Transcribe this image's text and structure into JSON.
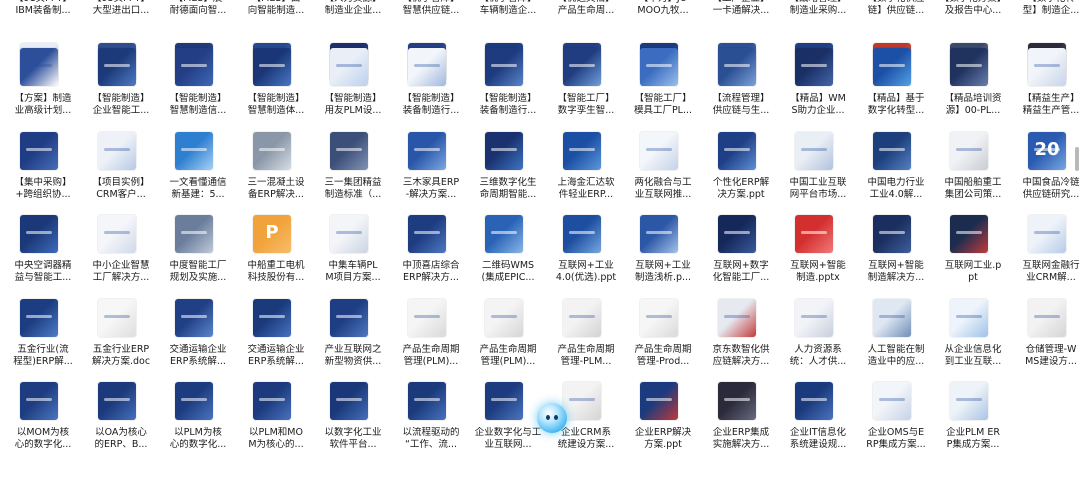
{
  "files": [
    {
      "line1": "【91页PPT】",
      "line2": "IBM装备制...",
      "thumb": "#e8eef8",
      "thumb_b": "#c9d7ef",
      "thumb_text": "",
      "light": true
    },
    {
      "line1": "【93页PPT】",
      "line2": "大型进出口...",
      "thumb": "#2f4d8e",
      "thumb_b": "#5b86c9",
      "thumb_text": ""
    },
    {
      "line1": "【MES】展",
      "line2": "耐德面向智...",
      "thumb": "#1f3a78",
      "thumb_b": "#4a6fb5",
      "thumb_text": ""
    },
    {
      "line1": "【MES】面",
      "line2": "向智能制造...",
      "thumb": "#274a8f",
      "thumb_b": "#6f93d1",
      "thumb_text": ""
    },
    {
      "line1": "【人力资源】",
      "line2": "制造业企业...",
      "thumb": "#1d2f6b",
      "thumb_b": "#3b5aa8",
      "thumb_text": ""
    },
    {
      "line1": "【优学智库】",
      "line2": "智慧供应链...",
      "thumb": "#243f86",
      "thumb_b": "#5c7fc6",
      "thumb_text": ""
    },
    {
      "line1": "【优学智库】",
      "line2": "车辆制造企...",
      "thumb": "#1b3c7c",
      "thumb_b": "#2f6bc0",
      "thumb_text": ""
    },
    {
      "line1": "【优选文档】",
      "line2": "产品生命周...",
      "thumb": "#233d83",
      "thumb_b": "#4e76c2",
      "thumb_text": ""
    },
    {
      "line1": "【华为】JO",
      "line2": "MOO九牧...",
      "thumb": "#1a3b7d",
      "thumb_b": "#3f6cc0",
      "thumb_text": ""
    },
    {
      "line1": "【工厂企业】",
      "line2": "一卡通解决...",
      "thumb": "#2c4f95",
      "thumb_b": "#8aa8dc",
      "thumb_text": ""
    },
    {
      "line1": "【战略管理】",
      "line2": "制造业采购...",
      "thumb": "#1f3f83",
      "thumb_b": "#5e84c8",
      "thumb_text": ""
    },
    {
      "line1": "【数字化供应",
      "line2": "链】供应链...",
      "thumb": "#c0392b",
      "thumb_b": "#e07a5f",
      "thumb_text": ""
    },
    {
      "line1": "【数字化方案】",
      "line2": "及报告中心...",
      "thumb": "#3a4a6b",
      "thumb_b": "#c9b18a",
      "thumb_text": ""
    },
    {
      "line1": "【数字化转",
      "line2": "型】制造企...",
      "thumb": "#2b2b3a",
      "thumb_b": "#7a7fa0",
      "thumb_text": ""
    },
    {
      "line1": "【方案】制造",
      "line2": "业高级计划...",
      "thumb": "#2d4f9a",
      "thumb_b": "#ffffff",
      "thumb_text": "",
      "light": true
    },
    {
      "line1": "【智能制造】",
      "line2": "企业智能工...",
      "thumb": "#1c3a7a",
      "thumb_b": "#4f7bc4",
      "thumb_text": ""
    },
    {
      "line1": "【智能制造】",
      "line2": "智慧制造信...",
      "thumb": "#233e85",
      "thumb_b": "#3d69b8",
      "thumb_text": ""
    },
    {
      "line1": "【智能制造】",
      "line2": "智慧制造体...",
      "thumb": "#1a3676",
      "thumb_b": "#4a78c4",
      "thumb_text": ""
    },
    {
      "line1": "【智能制造】",
      "line2": "用友PLM设...",
      "thumb": "#e9eef7",
      "thumb_b": "#bcd0ec",
      "thumb_text": "",
      "light": true
    },
    {
      "line1": "【智能制造】",
      "line2": "装备制造行...",
      "thumb": "#f2f5fa",
      "thumb_b": "#9fb8de",
      "thumb_text": "",
      "light": true
    },
    {
      "line1": "【智能制造】",
      "line2": "装备制造行...",
      "thumb": "#1d3b7e",
      "thumb_b": "#5a85c9",
      "thumb_text": ""
    },
    {
      "line1": "【智能工厂】",
      "line2": "数字孪生智...",
      "thumb": "#203d80",
      "thumb_b": "#6fa0dc",
      "thumb_text": ""
    },
    {
      "line1": "【智能工厂】",
      "line2": "模具工厂PL...",
      "thumb": "#3a6cc0",
      "thumb_b": "#9cc0ec",
      "thumb_text": ""
    },
    {
      "line1": "【流程管理】",
      "line2": "供应链与生...",
      "thumb": "#2a4f93",
      "thumb_b": "#7da2da",
      "thumb_text": ""
    },
    {
      "line1": "【精品】WM",
      "line2": "S助力企业...",
      "thumb": "#192f66",
      "thumb_b": "#4466aa",
      "thumb_text": ""
    },
    {
      "line1": "【精品】基于",
      "line2": "数字化转型...",
      "thumb": "#1c4fa6",
      "thumb_b": "#53a1e6",
      "thumb_text": ""
    },
    {
      "line1": "【精品培训资",
      "line2": "源】00-PL...",
      "thumb": "#20325e",
      "thumb_b": "#6a7fae",
      "thumb_text": ""
    },
    {
      "line1": "【精益生产】",
      "line2": "精益生产管...",
      "thumb": "#f1f4f9",
      "thumb_b": "#c7d4ea",
      "thumb_text": "",
      "light": true
    },
    {
      "line1": "【集中采购】",
      "line2": "+跨组织协...",
      "thumb": "#1f3d84",
      "thumb_b": "#486fba",
      "thumb_text": ""
    },
    {
      "line1": "【项目实例】",
      "line2": "CRM客户...",
      "thumb": "#eef2f8",
      "thumb_b": "#b8c9e4",
      "thumb_text": "",
      "light": true
    },
    {
      "line1": "一文看懂通信",
      "line2": "新基建：5...",
      "thumb": "#2f7fd0",
      "thumb_b": "#a5d2f5",
      "thumb_text": ""
    },
    {
      "line1": "三一混凝土设",
      "line2": "备ERP解决...",
      "thumb": "#8a97a8",
      "thumb_b": "#d7dde6",
      "thumb_text": ""
    },
    {
      "line1": "三一集团精益",
      "line2": "制造标准（...",
      "thumb": "#3b4f78",
      "thumb_b": "#8293b5",
      "thumb_text": ""
    },
    {
      "line1": "三木家具ERP",
      "line2": "-解决方案...",
      "thumb": "#2956a8",
      "thumb_b": "#7ca8e3",
      "thumb_text": ""
    },
    {
      "line1": "三维数字化生",
      "line2": "命周期智能...",
      "thumb": "#1a3370",
      "thumb_b": "#3f74c5",
      "thumb_text": ""
    },
    {
      "line1": "上海金汇达软",
      "line2": "件轻业ERP...",
      "thumb": "#1a4fa3",
      "thumb_b": "#5e97dc",
      "thumb_text": ""
    },
    {
      "line1": "两化融合与工",
      "line2": "业互联网推...",
      "thumb": "#f3f6fa",
      "thumb_b": "#c3d2ea",
      "thumb_text": "",
      "light": true
    },
    {
      "line1": "个性化ERP解",
      "line2": "决方案.ppt",
      "thumb": "#1e3f86",
      "thumb_b": "#5f8fd5",
      "thumb_text": ""
    },
    {
      "line1": "中国工业互联",
      "line2": "网平台市场...",
      "thumb": "#eaeef5",
      "thumb_b": "#b1c2de",
      "thumb_text": "",
      "light": true
    },
    {
      "line1": "中国电力行业",
      "line2": "工业4.0解...",
      "thumb": "#1d3f7c",
      "thumb_b": "#5680c2",
      "thumb_text": ""
    },
    {
      "line1": "中国船舶重工",
      "line2": "集团公司策...",
      "thumb": "#f0f2f5",
      "thumb_b": "#c8ccd4",
      "thumb_text": "",
      "light": true
    },
    {
      "line1": "中国食品冷链",
      "line2": "供应链研究...",
      "thumb": "#2a5bb0",
      "thumb_b": "#79a7e2",
      "thumb_text": "20"
    },
    {
      "line1": "中央空调器精",
      "line2": "益与智能工...",
      "thumb": "#1b3978",
      "thumb_b": "#3e6bbd",
      "thumb_text": ""
    },
    {
      "line1": "中小企业智慧",
      "line2": "工厂解决方...",
      "thumb": "#f4f6fa",
      "thumb_b": "#d0d9ea",
      "thumb_text": "",
      "light": true
    },
    {
      "line1": "中度智能工厂",
      "line2": "规划及实施...",
      "thumb": "#6a7e9c",
      "thumb_b": "#c0cad9",
      "thumb_text": ""
    },
    {
      "line1": "中船重工电机",
      "line2": "科技股份有...",
      "thumb": "#f2a23a",
      "thumb_b": "#f6bd6a",
      "thumb_text": "P",
      "orange": true
    },
    {
      "line1": "中集车辆PL",
      "line2": "M项目方案...",
      "thumb": "#f3f5f8",
      "thumb_b": "#cbd4e2",
      "thumb_text": "",
      "light": true
    },
    {
      "line1": "中顶喜店综合",
      "line2": "ERP解决方...",
      "thumb": "#1e3c80",
      "thumb_b": "#4d79c2",
      "thumb_text": ""
    },
    {
      "line1": "二维码WMS",
      "line2": "(集成EPIC...",
      "thumb": "#2a63b5",
      "thumb_b": "#8ab7ea",
      "thumb_text": ""
    },
    {
      "line1": "互联网+工业",
      "line2": "4.0(优选).ppt",
      "thumb": "#1e4ea0",
      "thumb_b": "#78a8e0",
      "thumb_text": ""
    },
    {
      "line1": "互联网+工业",
      "line2": "制造浅析.p...",
      "thumb": "#2c56a6",
      "thumb_b": "#a4c3ea",
      "thumb_text": ""
    },
    {
      "line1": "互联网+数字",
      "line2": "化智能工厂...",
      "thumb": "#15285a",
      "thumb_b": "#3a5a9c",
      "thumb_text": ""
    },
    {
      "line1": "互联网+智能",
      "line2": "制造.pptx",
      "thumb": "#d42f2f",
      "thumb_b": "#f07b7b",
      "thumb_text": ""
    },
    {
      "line1": "互联网+智能",
      "line2": "制造解决方...",
      "thumb": "#1a2e5f",
      "thumb_b": "#3f5f9e",
      "thumb_text": ""
    },
    {
      "line1": "互联网工业.p",
      "line2": "pt",
      "thumb": "#1b2c4f",
      "thumb_b": "#c53b3b",
      "thumb_text": ""
    },
    {
      "line1": "互联网金融行",
      "line2": "业CRM解...",
      "thumb": "#eef3fa",
      "thumb_b": "#b7cbe8",
      "thumb_text": "",
      "light": true
    },
    {
      "line1": "五金行业(流",
      "line2": "程型)ERP解...",
      "thumb": "#1c3d82",
      "thumb_b": "#4f7dc6",
      "thumb_text": ""
    },
    {
      "line1": "五金行业ERP",
      "line2": "解决方案.doc",
      "thumb": "#f7f7f7",
      "thumb_b": "#dedede",
      "thumb_text": "",
      "light": true
    },
    {
      "line1": "交通运输企业",
      "line2": "ERP系统解...",
      "thumb": "#203f85",
      "thumb_b": "#5c86cb",
      "thumb_text": ""
    },
    {
      "line1": "交通运输企业",
      "line2": "ERP系统解...",
      "thumb": "#1a3a7c",
      "thumb_b": "#4873bf",
      "thumb_text": ""
    },
    {
      "line1": "产业互联网之",
      "line2": "新型物资供...",
      "thumb": "#1e3d82",
      "thumb_b": "#5178c2",
      "thumb_text": ""
    },
    {
      "line1": "产品生命周期",
      "line2": "管理(PLM)...",
      "thumb": "#f5f5f5",
      "thumb_b": "#d9d9d9",
      "thumb_text": "",
      "light": true
    },
    {
      "line1": "产品生命周期",
      "line2": "管理(PLM)...",
      "thumb": "#f4f4f4",
      "thumb_b": "#d6d6d6",
      "thumb_text": "",
      "light": true
    },
    {
      "line1": "产品生命周期",
      "line2": "管理-PLM...",
      "thumb": "#f3f3f3",
      "thumb_b": "#d3d3d3",
      "thumb_text": "",
      "light": true
    },
    {
      "line1": "产品生命周期",
      "line2": "管理-Prod...",
      "thumb": "#f6f6f6",
      "thumb_b": "#dadada",
      "thumb_text": "",
      "light": true
    },
    {
      "line1": "京东数智化供",
      "line2": "应链解决方...",
      "thumb": "#e6e9ef",
      "thumb_b": "#c23b3b",
      "thumb_text": "",
      "light": true
    },
    {
      "line1": "人力资源系",
      "line2": "统：人才供...",
      "thumb": "#f2f4f8",
      "thumb_b": "#c7cfdd",
      "thumb_text": "",
      "light": true
    },
    {
      "line1": "人工智能在制",
      "line2": "造业中的应...",
      "thumb": "#dfe8f2",
      "thumb_b": "#6f8fb8",
      "thumb_text": "",
      "light": true
    },
    {
      "line1": "从企业信息化",
      "line2": "到工业互联...",
      "thumb": "#eef4fb",
      "thumb_b": "#9ec2e8",
      "thumb_text": "",
      "light": true
    },
    {
      "line1": "仓储管理-W",
      "line2": "MS建设方...",
      "thumb": "#f2f2f2",
      "thumb_b": "#d5d5d5",
      "thumb_text": "",
      "light": true
    },
    {
      "line1": "以MOM为核",
      "line2": "心的数字化...",
      "thumb": "#1e3c80",
      "thumb_b": "#4b76c0",
      "thumb_text": ""
    },
    {
      "line1": "以OA为核心",
      "line2": "的ERP、B...",
      "thumb": "#1b397b",
      "thumb_b": "#4670bc",
      "thumb_text": ""
    },
    {
      "line1": "以PLM为核",
      "line2": "心的数字化...",
      "thumb": "#1d3b7f",
      "thumb_b": "#4a74bf",
      "thumb_text": ""
    },
    {
      "line1": "以PLM和MO",
      "line2": "M为核心的...",
      "thumb": "#1c3a7d",
      "thumb_b": "#4872be",
      "thumb_text": ""
    },
    {
      "line1": "以数字化工业",
      "line2": "软件平台...",
      "thumb": "#1a3879",
      "thumb_b": "#456fbb",
      "thumb_text": ""
    },
    {
      "line1": "以流程驱动的",
      "line2": "“工作、流...",
      "thumb": "#1b3a7c",
      "thumb_b": "#4772be",
      "thumb_text": ""
    },
    {
      "line1": "企业数字化与工",
      "line2": "业互联网...",
      "thumb": "#1d3c80",
      "thumb_b": "#4b76c1",
      "thumb_text": ""
    },
    {
      "line1": "企业CRM系",
      "line2": "统建设方案...",
      "thumb": "#f3f3f3",
      "thumb_b": "#d4d4d4",
      "thumb_text": "",
      "light": true
    },
    {
      "line1": "企业ERP解决",
      "line2": "方案.ppt",
      "thumb": "#1c3b7e",
      "thumb_b": "#c03a3a",
      "thumb_text": ""
    },
    {
      "line1": "企业ERP集成",
      "line2": "实施解决方...",
      "thumb": "#2a2a3a",
      "thumb_b": "#6a6a80",
      "thumb_text": ""
    },
    {
      "line1": "企业IT信息化",
      "line2": "系统建设规...",
      "thumb": "#1b3a7d",
      "thumb_b": "#4a74bf",
      "thumb_text": ""
    },
    {
      "line1": "企业OMS与E",
      "line2": "RP集成方案...",
      "thumb": "#f2f5f9",
      "thumb_b": "#c5d2e6",
      "thumb_text": "",
      "light": true
    },
    {
      "line1": "企业PLM ER",
      "line2": "P集成方案...",
      "thumb": "#eef3f9",
      "thumb_b": "#aac3e3",
      "thumb_text": "",
      "light": true
    }
  ]
}
